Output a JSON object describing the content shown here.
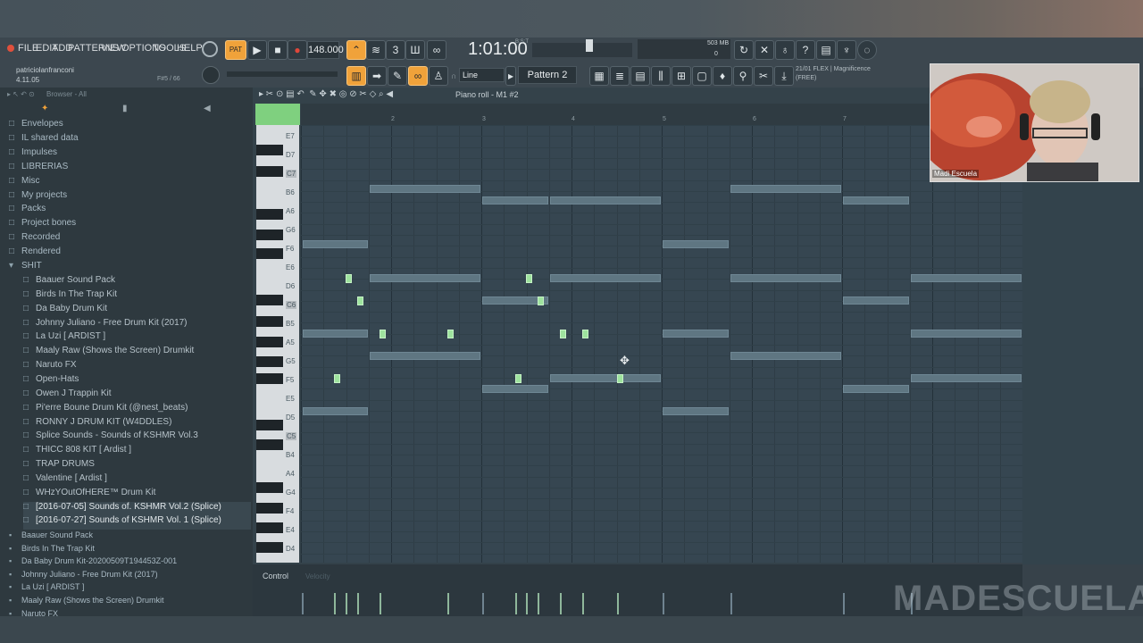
{
  "menu": [
    "FILE",
    "EDIT",
    "ADD",
    "PATTERNS",
    "VIEW",
    "OPTIONS",
    "TOOLS",
    "HELP"
  ],
  "transport": {
    "tempo": "148.000",
    "time": "1:01:00",
    "time_label": "B:S:T",
    "memory": "503 MB",
    "cpu_num": "0"
  },
  "hint": {
    "title": "patriciolanfranconi",
    "version": "4.11.05",
    "pattern_info": "F#5 / 66"
  },
  "snap": "Line",
  "pattern": "Pattern 2",
  "plugin_news": {
    "line1": "21/01 FLEX | Magnificence",
    "line2": "(FREE)"
  },
  "browser": {
    "header": "Browser - All",
    "folders": [
      "Envelopes",
      "IL shared data",
      "Impulses",
      "LIBRERIAS",
      "Misc",
      "My projects",
      "Packs",
      "Project bones",
      "Recorded",
      "Rendered",
      "SHIT"
    ],
    "subfolders": [
      "Baauer Sound Pack",
      "Birds In The Trap Kit",
      "Da Baby Drum Kit",
      "Johnny Juliano - Free Drum Kit (2017)",
      "La Uzi [ ARDIST ]",
      "Maaly Raw (Shows the Screen) Drumkit",
      "Naruto FX",
      "Open-Hats",
      "Owen J Trappin Kit",
      "Pi'erre Boune Drum Kit (@nest_beats)",
      "RONNY J DRUM KIT (W4DDLES)",
      "Splice Sounds - Sounds of KSHMR Vol.3",
      "THICC 808 KIT [ Ardist ]",
      "TRAP DRUMS",
      "Valentine [ Ardist ]",
      "WHzYOutOfHERE™ Drum Kit",
      "[2016-07-05] Sounds of. KSHMR Vol.2 (Splice)",
      "[2016-07-27] Sounds of KSHMR Vol. 1 (Splice)"
    ],
    "files": [
      "Baauer Sound Pack",
      "Birds In The Trap Kit",
      "Da Baby Drum Kit-20200509T194453Z-001",
      "Johnny Juliano - Free Drum Kit (2017)",
      "La Uzi [ ARDIST ]",
      "Maaly Raw (Shows the Screen) Drumkit",
      "Naruto FX"
    ]
  },
  "piano_roll": {
    "title": "Piano roll - M1 #2",
    "bars": [
      "2",
      "3",
      "4",
      "5",
      "6",
      "7"
    ],
    "keys": [
      "E7",
      "D7",
      "C7",
      "B6",
      "A6",
      "G6",
      "F6",
      "E6",
      "D6",
      "C6",
      "B5",
      "A5",
      "G5",
      "F5",
      "E5",
      "D5",
      "C5",
      "B4",
      "A4",
      "G4",
      "F4",
      "E4",
      "D4"
    ],
    "control_label": "Control",
    "control_sub": "Velocity"
  },
  "webcam": {
    "name": "Madi Escuela"
  },
  "watermark": "MADESCUELA",
  "colors": {
    "accent": "#f0a23a",
    "note": "#5f7682",
    "selected_note": "#9ee39e",
    "grid": "#364651"
  }
}
